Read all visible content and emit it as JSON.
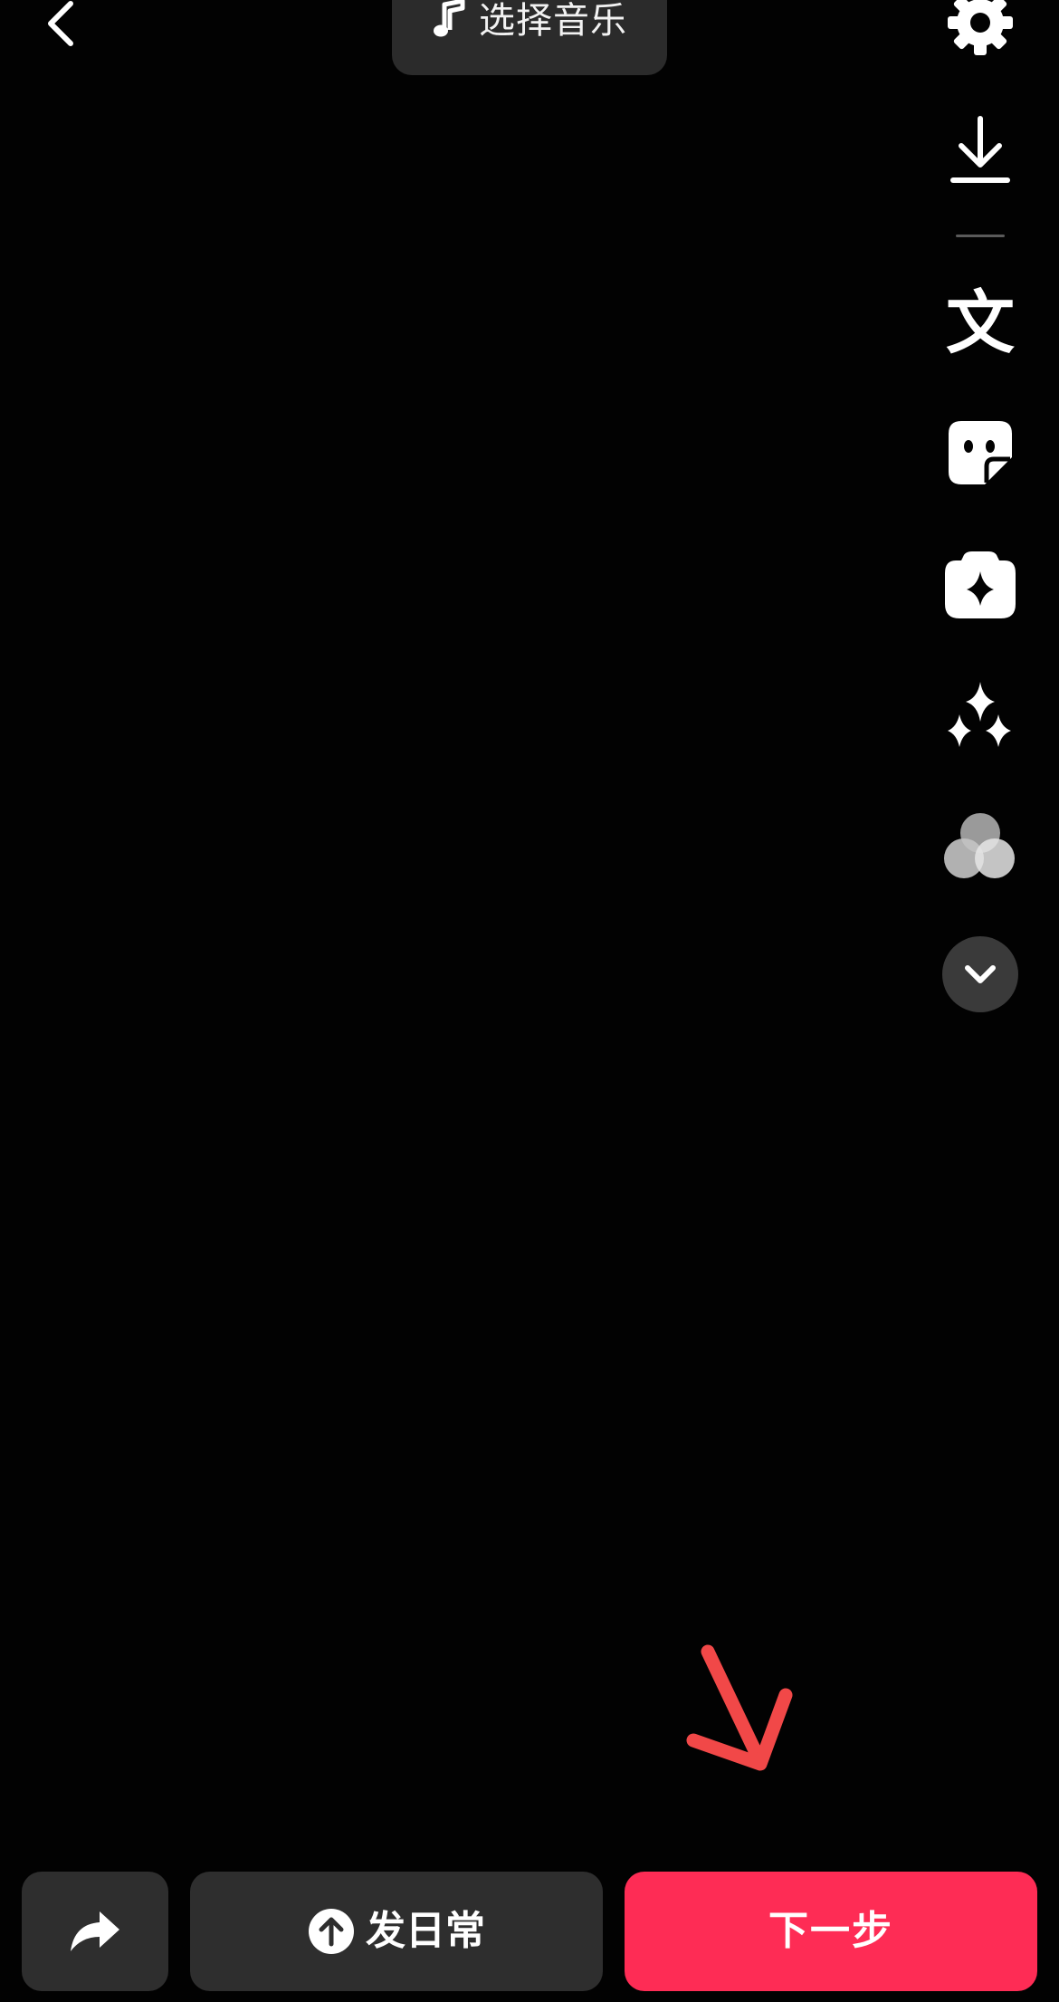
{
  "header": {
    "back_icon": "chevron-left-icon",
    "music": {
      "icon": "music-note-icon",
      "label": "选择音乐"
    }
  },
  "rail": {
    "items": [
      {
        "name": "settings",
        "icon": "gear-icon"
      },
      {
        "name": "download",
        "icon": "download-icon"
      },
      {
        "name": "text",
        "icon": "text-icon",
        "glyph": "文"
      },
      {
        "name": "sticker",
        "icon": "sticker-icon"
      },
      {
        "name": "effects",
        "icon": "sparkle-badge-icon"
      },
      {
        "name": "enhance",
        "icon": "sparkles-icon"
      },
      {
        "name": "filters",
        "icon": "filter-circles-icon"
      },
      {
        "name": "more",
        "icon": "chevron-down-icon"
      }
    ]
  },
  "bottom": {
    "share": {
      "icon": "share-arrow-icon"
    },
    "daily": {
      "icon": "upload-circle-icon",
      "label": "发日常"
    },
    "next": {
      "label": "下一步"
    }
  },
  "colors": {
    "background": "#020202",
    "accent": "#fe2c55",
    "annotation": "#f14848",
    "button_gray": "#2e2e2e"
  }
}
